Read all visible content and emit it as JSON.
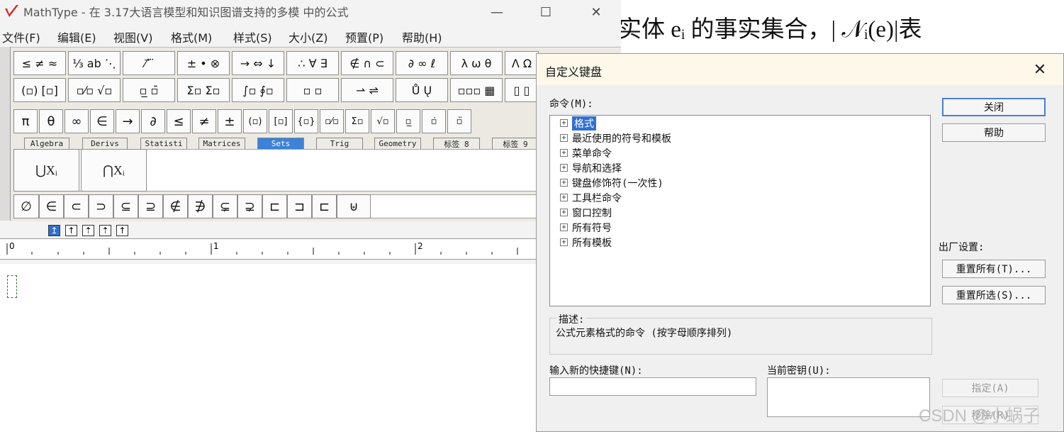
{
  "background_doc": {
    "text": "实体 eᵢ 的事实集合，| 𝒩ᵢ(e)|表"
  },
  "mathtype": {
    "title": "MathType - 在 3.17大语言模型和知识图谱支持的多模 中的公式",
    "window_buttons": {
      "minimize": "—",
      "maximize": "☐",
      "close": "✕"
    },
    "menu": [
      "文件(F)",
      "编辑(E)",
      "视图(V)",
      "格式(M)",
      "样式(S)",
      "大小(Z)",
      "预置(P)",
      "帮助(H)"
    ],
    "palette_row1": [
      "≤ ≠ ≈",
      "⅓ ab ⋱",
      "⁄ ⃗ ⃛",
      "± • ⊗",
      "→ ⇔ ↓",
      "∴ ∀ ∃",
      "∉ ∩ ⊂",
      "∂ ∞ ℓ",
      "λ ω θ",
      "Λ Ω"
    ],
    "palette_row2": [
      "(▫) [▫]",
      "▫⁄▫ √▫",
      "▫̲ ▫̄",
      "Σ▫ Σ▫",
      "∫▫ ∮▫",
      "▫ ▫",
      "⇀ ⇌",
      "Ů Ų",
      "▫▫▫ ▦",
      "▯ ▯"
    ],
    "symbols_row": [
      "π",
      "θ",
      "∞",
      "∈",
      "→",
      "∂",
      "≤",
      "≠",
      "±",
      "(▫)",
      "[▫]",
      "{▫}",
      "▫⁄▫",
      "Σ▫",
      "√▫",
      "▫̲",
      "▫̇",
      "▫̈"
    ],
    "tabs": [
      "Algebra",
      "Derivs",
      "Statisti",
      "Matrices",
      "Sets",
      "Trig",
      "Geometry",
      "标签 8",
      "标签 9"
    ],
    "active_tab": "Sets",
    "templates": [
      "⋃Xᵢ",
      "⋂Xᵢ"
    ],
    "set_symbols": [
      "∅",
      "∈",
      "⊂",
      "⊃",
      "⊆",
      "⊇",
      "∉",
      "∌",
      "⊊",
      "⊋",
      "⊏",
      "⊐",
      "⊏",
      "⊎"
    ],
    "nudge_buttons": [
      "↥",
      "↑",
      "⇡",
      "⇡",
      "↑"
    ],
    "ruler": {
      "marks": [
        "0",
        "1",
        "2"
      ]
    }
  },
  "dialog": {
    "title": "自定义键盘",
    "close_glyph": "✕",
    "commands_label": "命令(M):",
    "tree": [
      {
        "label": "格式",
        "selected": true
      },
      {
        "label": "最近使用的符号和模板",
        "selected": false
      },
      {
        "label": "菜单命令",
        "selected": false
      },
      {
        "label": "导航和选择",
        "selected": false
      },
      {
        "label": "键盘修饰符(一次性)",
        "selected": false
      },
      {
        "label": "工具栏命令",
        "selected": false
      },
      {
        "label": "窗口控制",
        "selected": false
      },
      {
        "label": "所有符号",
        "selected": false
      },
      {
        "label": "所有模板",
        "selected": false
      }
    ],
    "buttons": {
      "close": "关闭",
      "help": "帮助",
      "factory_label": "出厂设置:",
      "reset_all": "重置所有(T)...",
      "reset_selected": "重置所选(S)...",
      "assign": "指定(A)",
      "remove": "移除(R)"
    },
    "description_label": "描述:",
    "description_text": "公式元素格式的命令  (按字母顺序排列)",
    "new_shortcut_label": "输入新的快捷键(N):",
    "new_shortcut_value": "",
    "current_keys_label": "当前密钥(U):",
    "current_keys_value": ""
  },
  "watermark": "CSDN @小蜗子"
}
